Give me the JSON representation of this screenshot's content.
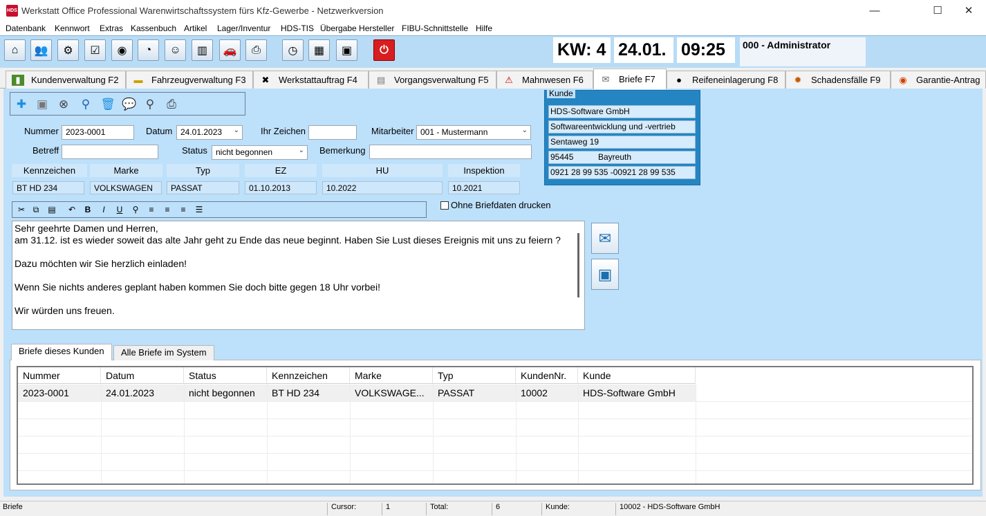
{
  "window": {
    "title": "Werkstatt Office Professional Warenwirtschaftssystem fürs Kfz-Gewerbe - Netzwerkversion",
    "logo_text": "HDS",
    "minimize": "—",
    "maximize": "☐",
    "close": "✕"
  },
  "menu": [
    "Datenbank",
    "Kennwort",
    "Extras",
    "Kassenbuch",
    "Artikel",
    "Lager/Inventur",
    "HDS-TIS",
    "Übergabe Hersteller",
    "FIBU-Schnittstelle",
    "Hilfe"
  ],
  "toolbar": {
    "icons": [
      "house-icon",
      "people-icon",
      "gear-icon",
      "checklist-icon",
      "globe-icon",
      "pie-chart-icon",
      "person-icon",
      "bar-chart-icon",
      "car-icon",
      "printer-icon",
      "clock-icon",
      "calendar-icon",
      "package-icon",
      "power-icon"
    ],
    "kw": "KW: 4",
    "date": "24.01.",
    "time": "09:25",
    "user": "000 - Administrator"
  },
  "tabs": [
    {
      "label": "Kundenverwaltung F2",
      "icon": "customers-icon"
    },
    {
      "label": "Fahrzeugverwaltung F3",
      "icon": "car-icon"
    },
    {
      "label": "Werkstattauftrag F4",
      "icon": "tools-icon"
    },
    {
      "label": "Vorgangsverwaltung F5",
      "icon": "document-icon"
    },
    {
      "label": "Mahnwesen F6",
      "icon": "warning-icon"
    },
    {
      "label": "Briefe F7",
      "icon": "envelope-icon",
      "active": true
    },
    {
      "label": "Reifeneinlagerung F8",
      "icon": "tire-icon"
    },
    {
      "label": "Schadensfälle F9",
      "icon": "damage-icon"
    },
    {
      "label": "Garantie-Antrag",
      "icon": "warranty-icon"
    }
  ],
  "form": {
    "nummer_label": "Nummer",
    "nummer": "2023-0001",
    "datum_label": "Datum",
    "datum": "24.01.2023",
    "ihr_zeichen_label": "Ihr Zeichen",
    "ihr_zeichen": "",
    "mitarbeiter_label": "Mitarbeiter",
    "mitarbeiter": "001 - Mustermann",
    "betreff_label": "Betreff",
    "betreff": "",
    "status_label": "Status",
    "status": "nicht begonnen",
    "bemerkung_label": "Bemerkung",
    "bemerkung": "",
    "ohne_briefdaten": "Ohne Briefdaten drucken"
  },
  "vehicle": {
    "headers": [
      "Kennzeichen",
      "Marke",
      "Typ",
      "EZ",
      "HU",
      "Inspektion"
    ],
    "values": [
      "BT HD 234",
      "VOLKSWAGEN",
      "PASSAT",
      "01.10.2013",
      "10.2022",
      "10.2021"
    ]
  },
  "kunde": {
    "legend": "Kunde",
    "name": "HDS-Software GmbH",
    "zusatz": "Softwareentwicklung und -vertrieb",
    "strasse": "Sentaweg 19",
    "plz": "95445",
    "ort": "Bayreuth",
    "telefon": "0921 28 99 535 -00921 28 99 535"
  },
  "letter": {
    "lines": [
      "Sehr geehrte Damen und Herren,",
      "am 31.12. ist es wieder soweit  das alte Jahr geht zu Ende  das neue beginnt. Haben Sie Lust  dieses Ereignis mit uns zu feiern ?",
      "",
      "Dazu möchten wir Sie herzlich einladen!",
      "",
      "Wenn Sie nichts anderes geplant haben  kommen Sie doch bitte gegen 18 Uhr vorbei!",
      "",
      "Wir würden uns freuen."
    ]
  },
  "bottom_tabs": [
    "Briefe dieses Kunden",
    "Alle Briefe im System"
  ],
  "table": {
    "columns": [
      "Nummer",
      "Datum",
      "Status",
      "Kennzeichen",
      "Marke",
      "Typ",
      "KundenNr.",
      "Kunde"
    ],
    "rows": [
      [
        "2023-0001",
        "24.01.2023",
        "nicht begonnen",
        "BT HD 234",
        "VOLKSWAGE...",
        "PASSAT",
        "10002",
        "HDS-Software GmbH"
      ]
    ]
  },
  "status": {
    "left": "Briefe",
    "cursor_label": "Cursor:",
    "cursor": "1",
    "total_label": "Total:",
    "total": "6",
    "kunde_label": "Kunde:",
    "kunde": "10002 - HDS-Software GmbH"
  }
}
